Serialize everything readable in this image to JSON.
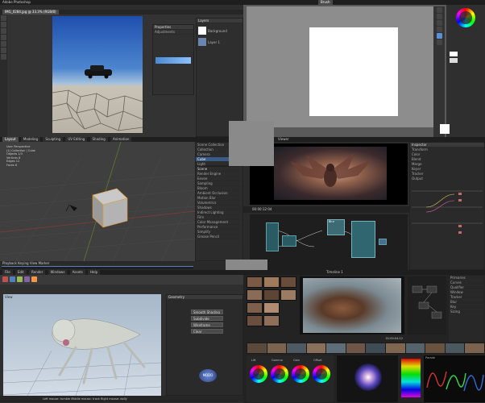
{
  "photoshop": {
    "title": "Adobe Photoshop",
    "doc_tab": "IMG_0284.jpg @ 33.3% (RGB/8)",
    "layers_header": "Layers",
    "layer_rows": [
      "Background",
      "Layer 1"
    ],
    "properties_header": "Properties",
    "props_label": "Adjustments"
  },
  "paint_app": {
    "menu_tab": "Brush"
  },
  "blender": {
    "header_tabs": [
      "Layout",
      "Modeling",
      "Sculpting",
      "UV Editing",
      "Shading",
      "Animation"
    ],
    "overlay_lines": [
      "User Perspective",
      "(1) Collection | Cube",
      "Objects 1/3",
      "Vertices 8",
      "Edges 12",
      "Faces 6"
    ],
    "properties_rows": [
      "Scene",
      "Render Engine",
      "Eevee",
      "Sampling",
      "Bloom",
      "Ambient Occlusion",
      "Motion Blur",
      "Volumetrics",
      "Shadows",
      "Indirect Lighting",
      "Film",
      "Color Management",
      "Performance",
      "Simplify",
      "Grease Pencil"
    ],
    "outliner_rows": [
      "Scene Collection",
      "Collection",
      "Camera",
      "Cube",
      "Light"
    ],
    "timeline_label": "Playback  Keying  View  Marker"
  },
  "compositor": {
    "viewer_label": "Viewer",
    "timecode": "00:00:12:04",
    "right_panel_rows": [
      "Inspector",
      "Transform",
      "Color",
      "Blend",
      "Merge",
      "Keyer",
      "Tracker",
      "Output"
    ],
    "node_label": "Blur"
  },
  "zbrush": {
    "menu": [
      "File",
      "Edit",
      "Render",
      "Windows",
      "Assets",
      "Help"
    ],
    "viewport_label": "View",
    "status_line": "Left mouse: tumble  Middle mouse: track  Right mouse: dolly",
    "panel_header": "Geometry",
    "panel_buttons": [
      "Smooth Shading",
      "Subdivide",
      "Wireframe",
      "Clear"
    ],
    "badge": "MODO"
  },
  "resolve": {
    "viewer_title": "Timeline 1",
    "tc": "01:00:04:12",
    "wheel_labels": [
      "Lift",
      "Gamma",
      "Gain",
      "Offset"
    ],
    "right_rows": [
      "Primaries",
      "Curves",
      "Qualifier",
      "Window",
      "Tracker",
      "Blur",
      "Key",
      "Sizing"
    ],
    "scope_label": "Parade"
  }
}
